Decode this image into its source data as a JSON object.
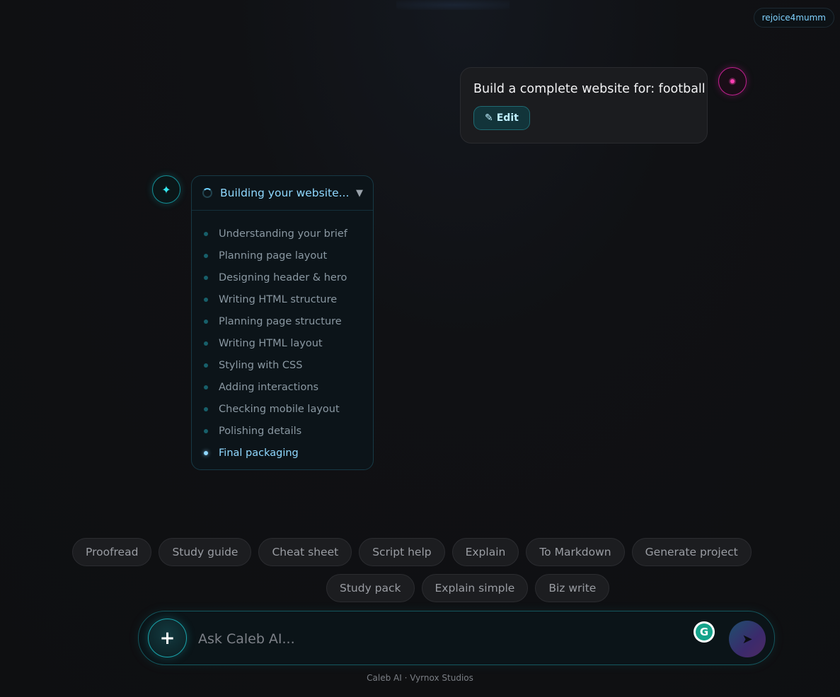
{
  "header": {
    "username": "rejoice4mumm"
  },
  "conversation": {
    "user_message": {
      "text": "Build a complete website for: football",
      "edit_label": "Edit",
      "edit_icon": "✎"
    },
    "assistant": {
      "avatar_icon": "✦",
      "progress_title": "Building your website...",
      "chevron_icon": "▼",
      "steps": [
        "Understanding your brief",
        "Planning page layout",
        "Designing header & hero",
        "Writing HTML structure",
        "Planning page structure",
        "Writing HTML layout",
        "Styling with CSS",
        "Adding interactions",
        "Checking mobile layout",
        "Polishing details",
        "Final packaging"
      ],
      "active_step_index": 10
    }
  },
  "quick_actions": {
    "row1": [
      "Proofread",
      "Study guide",
      "Cheat sheet",
      "Script help",
      "Explain",
      "To Markdown",
      "Generate project"
    ],
    "row2": [
      "Study pack",
      "Explain simple",
      "Biz write"
    ]
  },
  "composer": {
    "add_icon": "+",
    "placeholder": "Ask Caleb AI...",
    "grammarly_letter": "G",
    "send_icon": "➤"
  },
  "footer": {
    "text": "Caleb AI · Vyrnox Studios"
  },
  "colors": {
    "accent_cyan": "#34e6ee",
    "accent_blue": "#8fd8ff",
    "user_pink": "#ff3fb3"
  }
}
